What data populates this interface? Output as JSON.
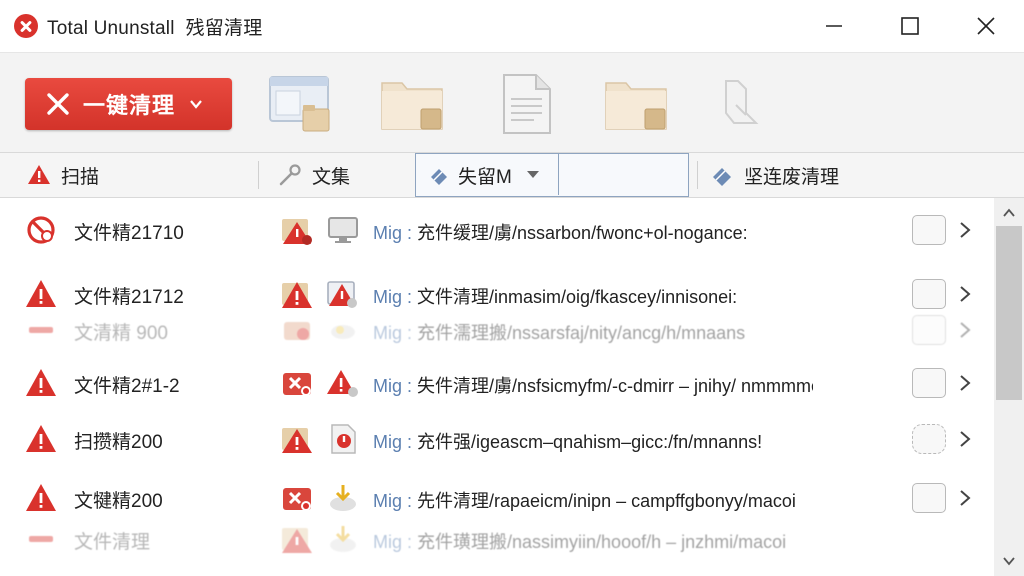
{
  "window": {
    "app_name": "Total Ununstall",
    "subtitle": "残留清理"
  },
  "toolbar": {
    "clean_button_label": "一键清理"
  },
  "tabs": {
    "scan_label": "扫描",
    "files_label": "文集",
    "dropdown_value": "失留M",
    "deep_clean_label": "坚连废清理"
  },
  "rows": [
    {
      "name": "文件精21710",
      "path_prefix": "Mig :",
      "path": " 充件缓理/虜/nssarbon/fwonc+ol-nogance:"
    },
    {
      "name": "文件精21712",
      "path_prefix": "Mig :",
      "path": " 文件清理/inmasim/oig/fkascey/innisonei:"
    },
    {
      "name": "文清精 900",
      "path_prefix": "Mig :",
      "path": " 充件濡理搬/nssarsfaj/nity/ancg/h/mnaans"
    },
    {
      "name": "文件精2#1-2",
      "path_prefix": "Mig :",
      "path": " 失件清理/虜/nsfsicmyfm/-c-dmirr – jnihy/ nmmmmen:"
    },
    {
      "name": "扫攒精200",
      "path_prefix": "Mig :",
      "path": " 充件强/igeascm–qnahism–gicc:/fn/mnanns!"
    },
    {
      "name": "文犍精200",
      "path_prefix": "Mig :",
      "path": " 先件清理/rapaeicm/inipn – campffgbonyy/macoi"
    },
    {
      "name": "文件清理",
      "path_prefix": "Mig :",
      "path": " 充件璜理搬/nassimyiin/hooof/h – jnzhmi/macoi"
    }
  ]
}
